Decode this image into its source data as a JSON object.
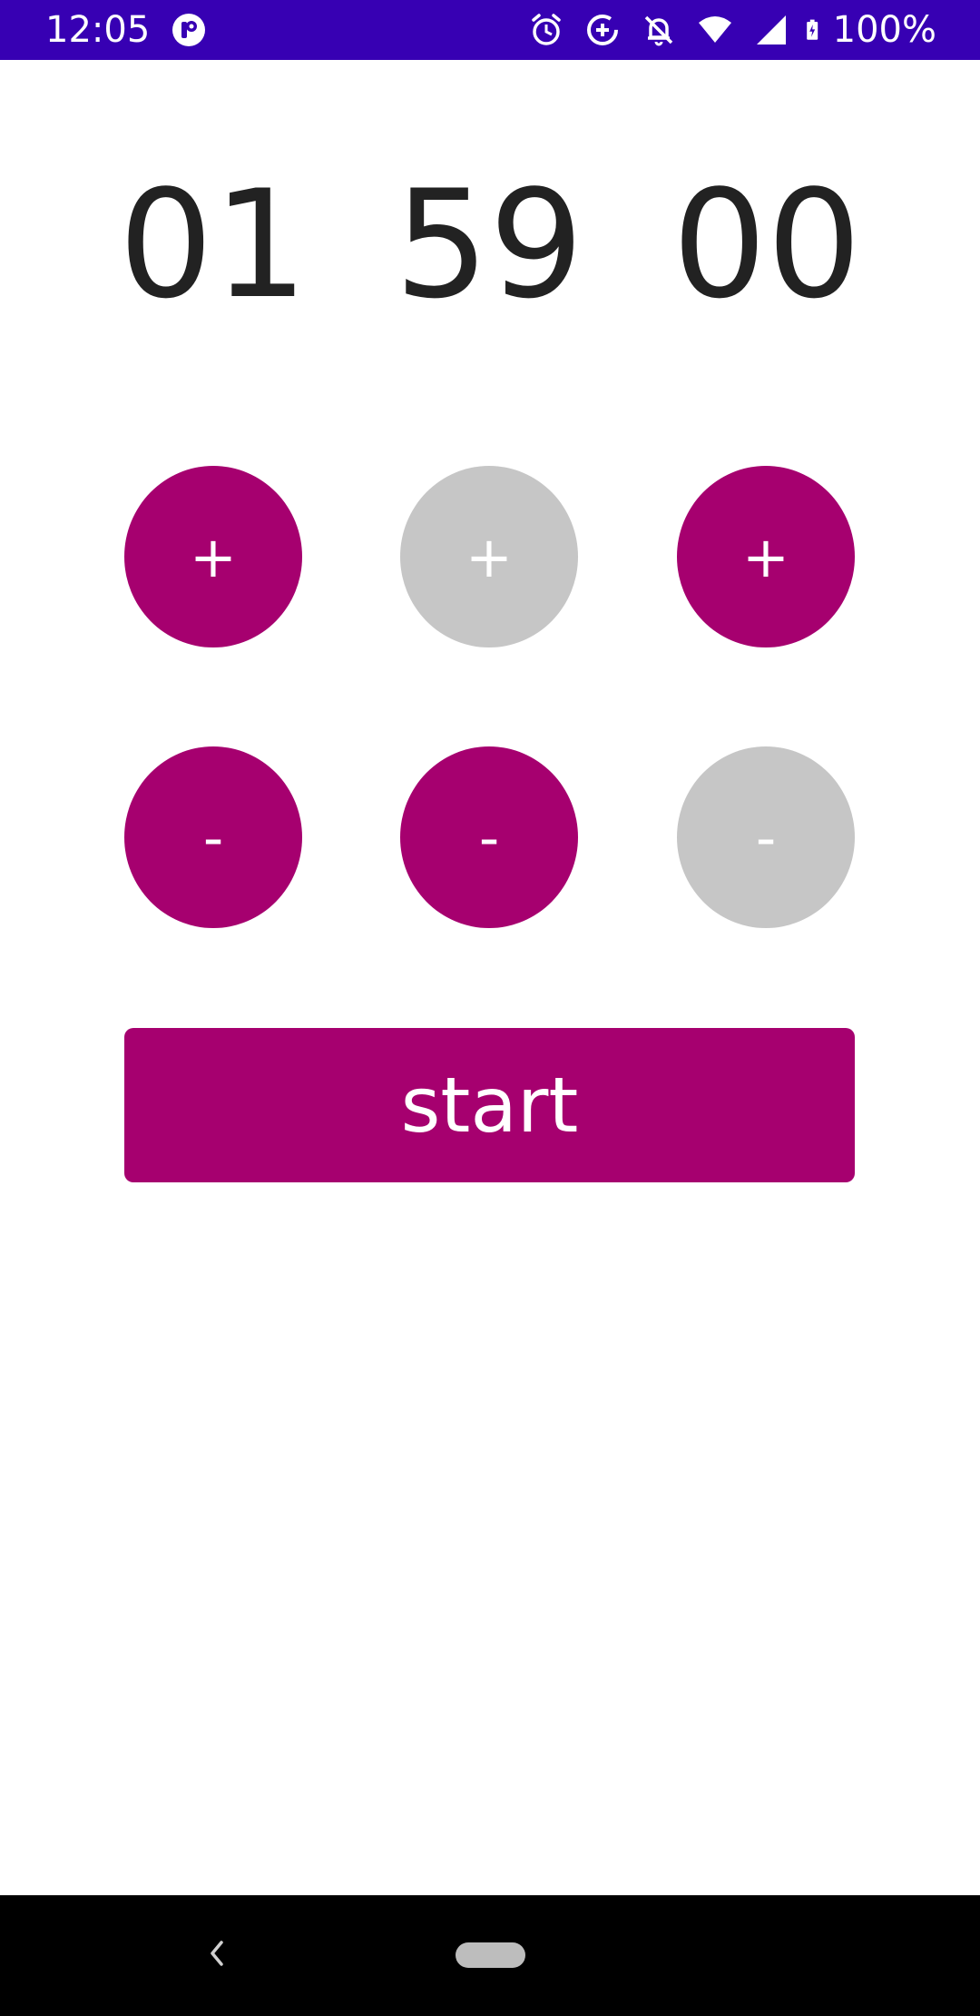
{
  "status_bar": {
    "time": "12:05",
    "battery_text": "100%",
    "icons": [
      "app-notification-icon",
      "alarm-icon",
      "data-saver-icon",
      "notifications-off-icon",
      "wifi-icon",
      "cell-signal-icon",
      "battery-charging-icon"
    ]
  },
  "timer": {
    "hours": "01",
    "minutes": "59",
    "seconds": "00"
  },
  "controls": {
    "plus_label": "+",
    "minus_label": "-",
    "hours_plus_enabled": true,
    "minutes_plus_enabled": false,
    "seconds_plus_enabled": true,
    "hours_minus_enabled": true,
    "minutes_minus_enabled": true,
    "seconds_minus_enabled": false
  },
  "start_button": {
    "label": "start"
  },
  "colors": {
    "status_bar": "#3700b3",
    "accent": "#a6006f",
    "disabled": "#c6c6c6",
    "digit_text": "#222222"
  }
}
